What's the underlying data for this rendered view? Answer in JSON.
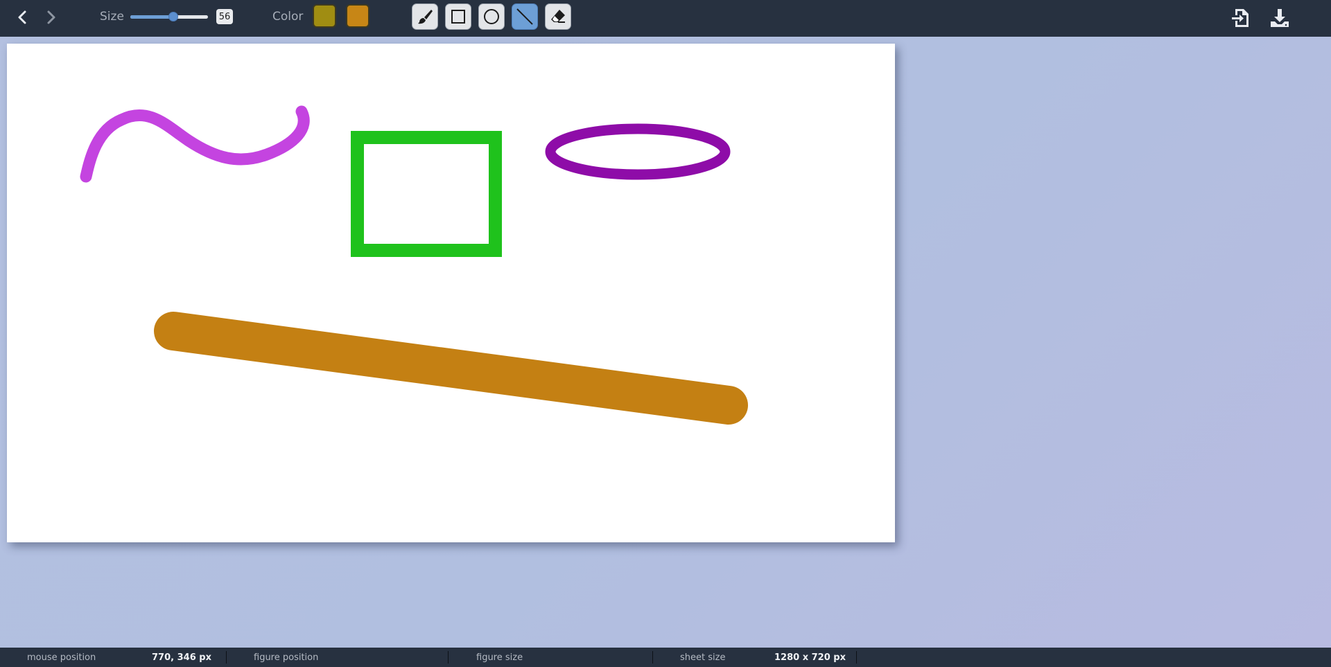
{
  "toolbar": {
    "size_label": "Size",
    "size_value": "56",
    "size_slider_fraction": 0.55,
    "color_label": "Color",
    "colors": {
      "primary": "#a08d12",
      "secondary": "#c78616"
    },
    "tools": [
      {
        "name": "brush",
        "icon": "brush-icon",
        "active": false
      },
      {
        "name": "rectangle",
        "icon": "square-icon",
        "active": false
      },
      {
        "name": "circle",
        "icon": "circle-icon",
        "active": false
      },
      {
        "name": "line",
        "icon": "line-icon",
        "active": true
      },
      {
        "name": "eraser",
        "icon": "eraser-icon",
        "active": false
      }
    ],
    "nav": {
      "back_icon": "chevron-left-icon",
      "forward_icon": "chevron-right-icon"
    },
    "actions": {
      "import_icon": "import-file-icon",
      "download_icon": "download-icon"
    }
  },
  "canvas": {
    "figures": [
      {
        "type": "freehand",
        "color": "#c444e0"
      },
      {
        "type": "rectangle",
        "color": "#1fc21c"
      },
      {
        "type": "ellipse",
        "color": "#8e0ca8"
      },
      {
        "type": "line",
        "color": "#c48013"
      }
    ]
  },
  "status": {
    "mouse_position_label": "mouse position",
    "mouse_position_value": "770, 346 px",
    "figure_position_label": "figure position",
    "figure_position_value": "",
    "figure_size_label": "figure size",
    "figure_size_value": "",
    "sheet_size_label": "sheet size",
    "sheet_size_value": "1280 x 720 px"
  },
  "theme": {
    "toolbar_bg": "#273140",
    "active_tool": "#6d9fd6",
    "background": "#b3c0e0"
  }
}
